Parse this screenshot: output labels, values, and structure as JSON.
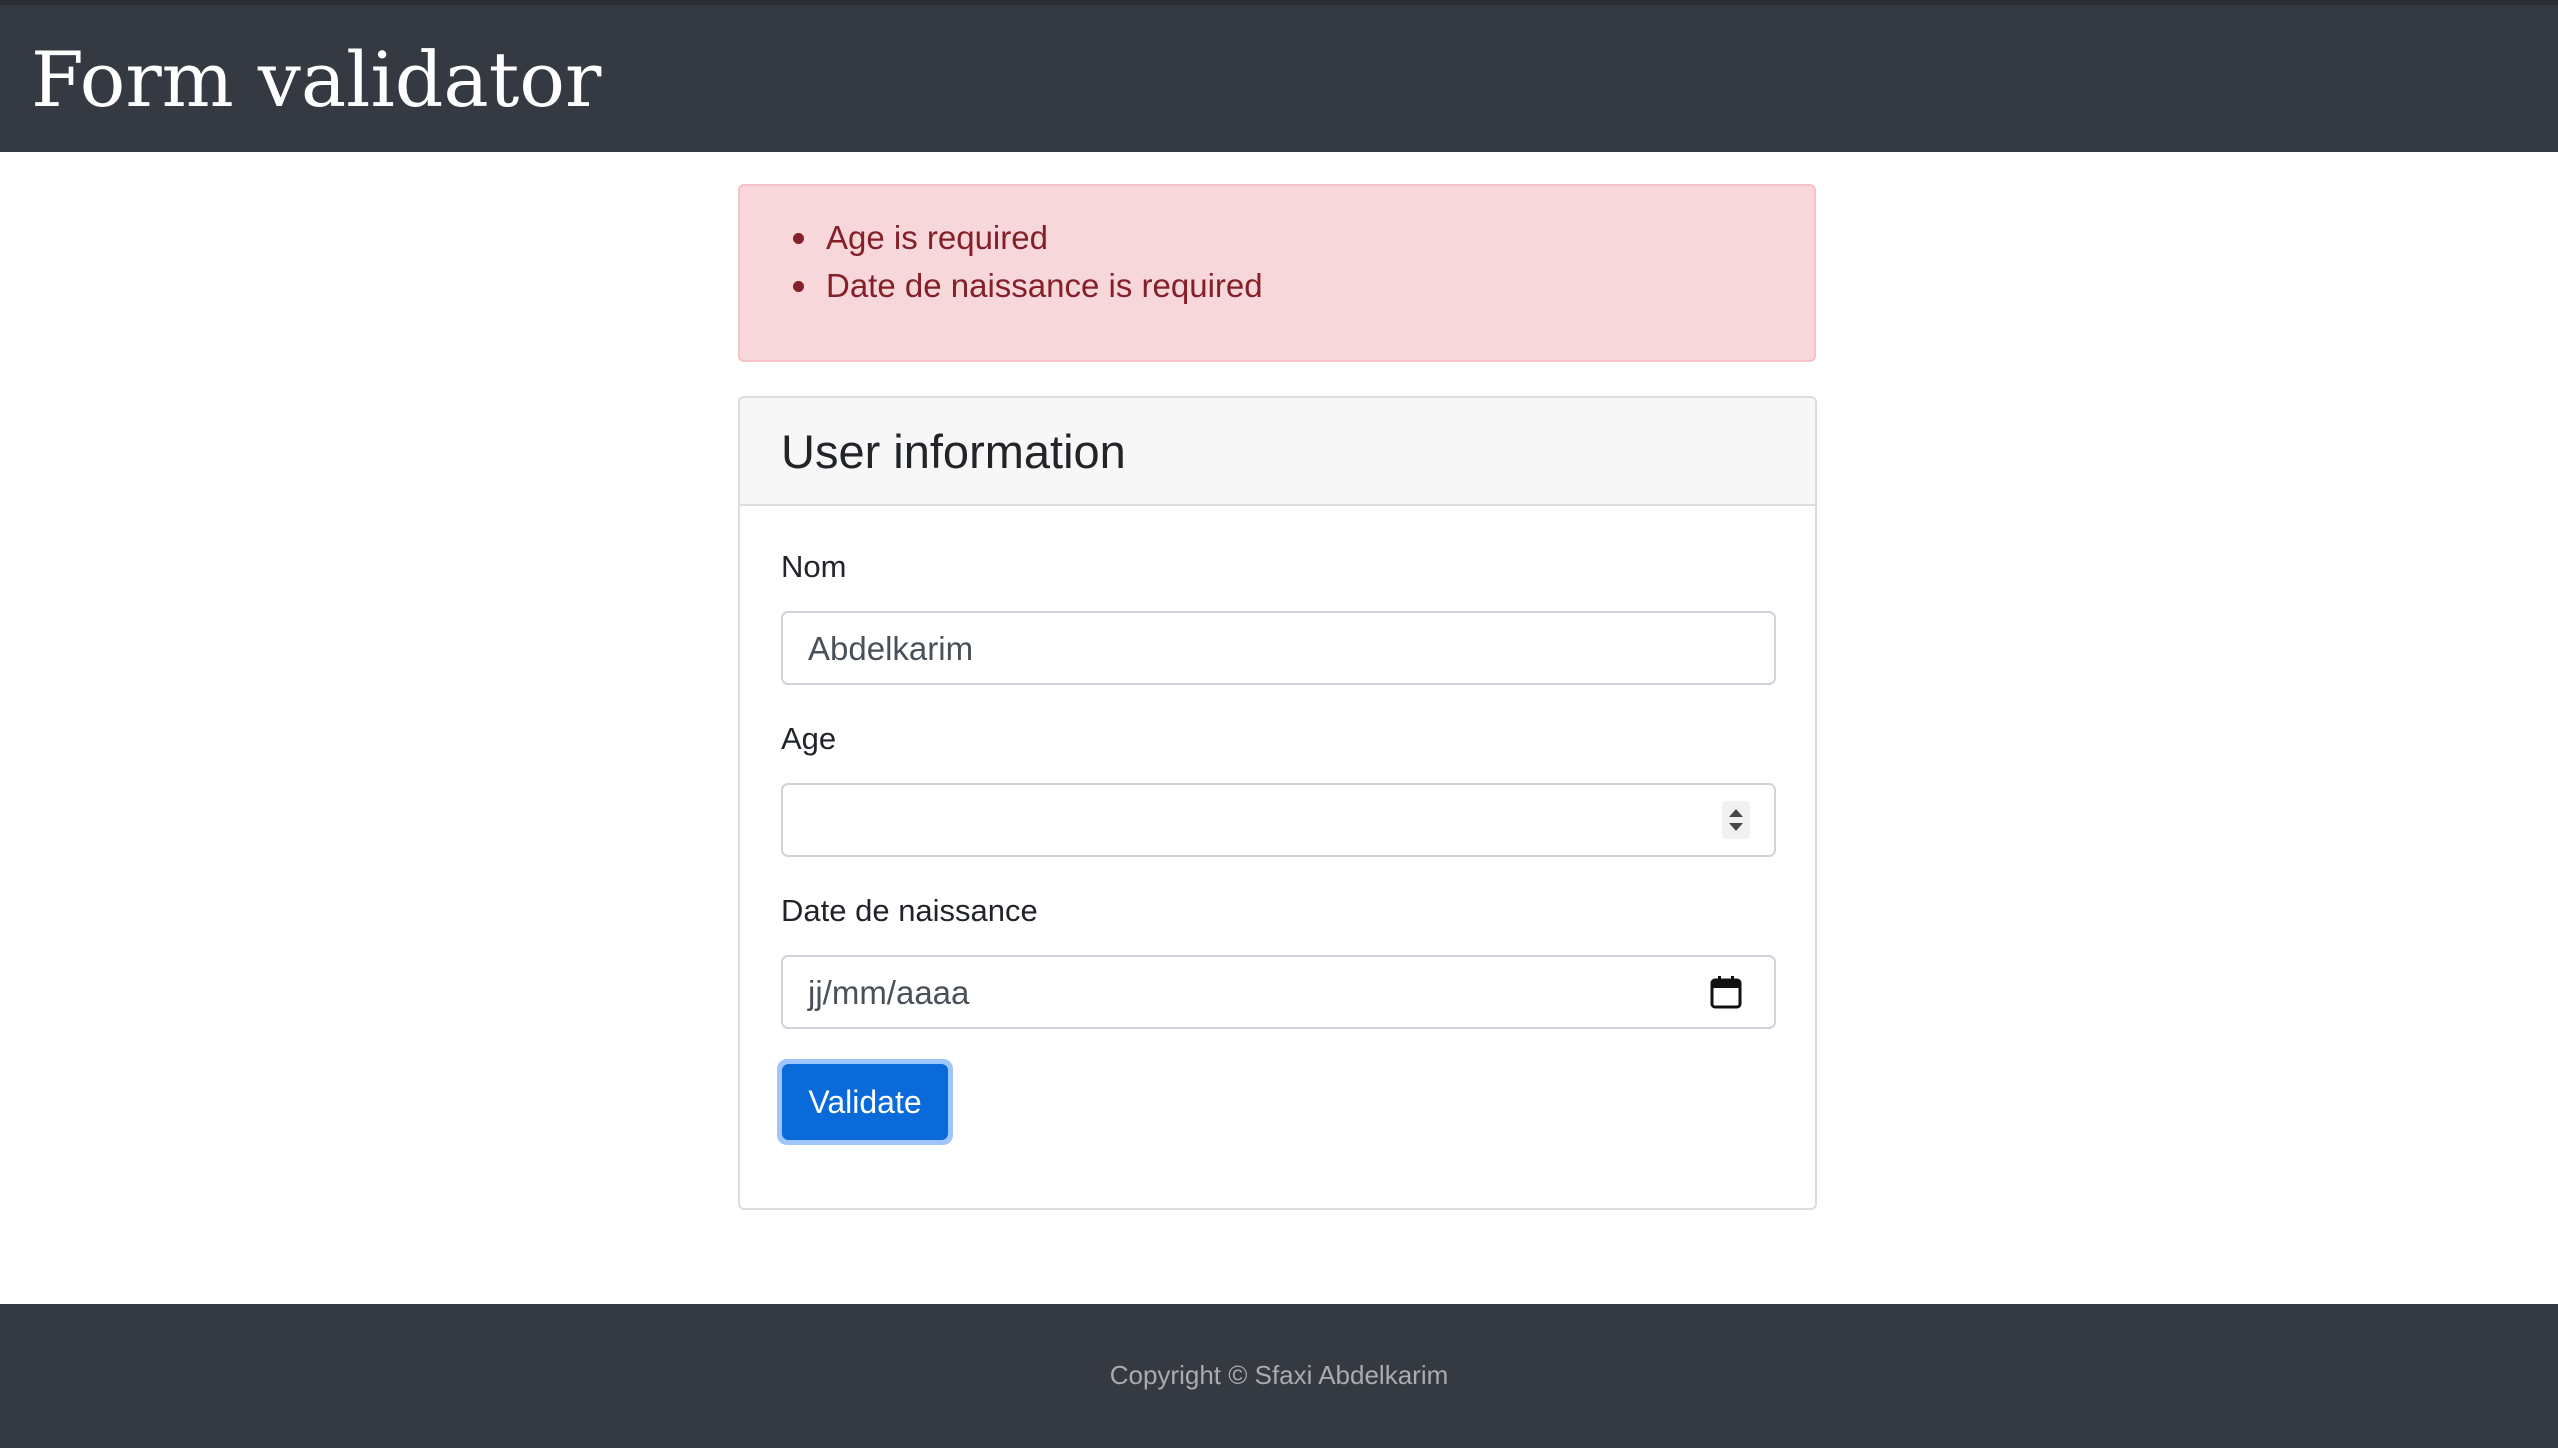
{
  "header": {
    "title": "Form validator"
  },
  "alert": {
    "errors": [
      "Age is required",
      "Date de naissance is required"
    ]
  },
  "card": {
    "title": "User information"
  },
  "form": {
    "nom": {
      "label": "Nom",
      "value": "Abdelkarim"
    },
    "age": {
      "label": "Age",
      "value": ""
    },
    "birthdate": {
      "label": "Date de naissance",
      "placeholder": "jj/mm/aaaa"
    },
    "submit_label": "Validate"
  },
  "footer": {
    "copyright": "Copyright © Sfaxi Abdelkarim"
  },
  "colors": {
    "header_bg": "#353a42",
    "alert_bg": "#f8d7da",
    "alert_text": "#842029",
    "button_bg": "#0b6ad9",
    "button_focus_ring": "#9ec5fe"
  },
  "icons": {
    "age_stepper": "spinner-icon",
    "date_picker": "calendar-icon"
  }
}
